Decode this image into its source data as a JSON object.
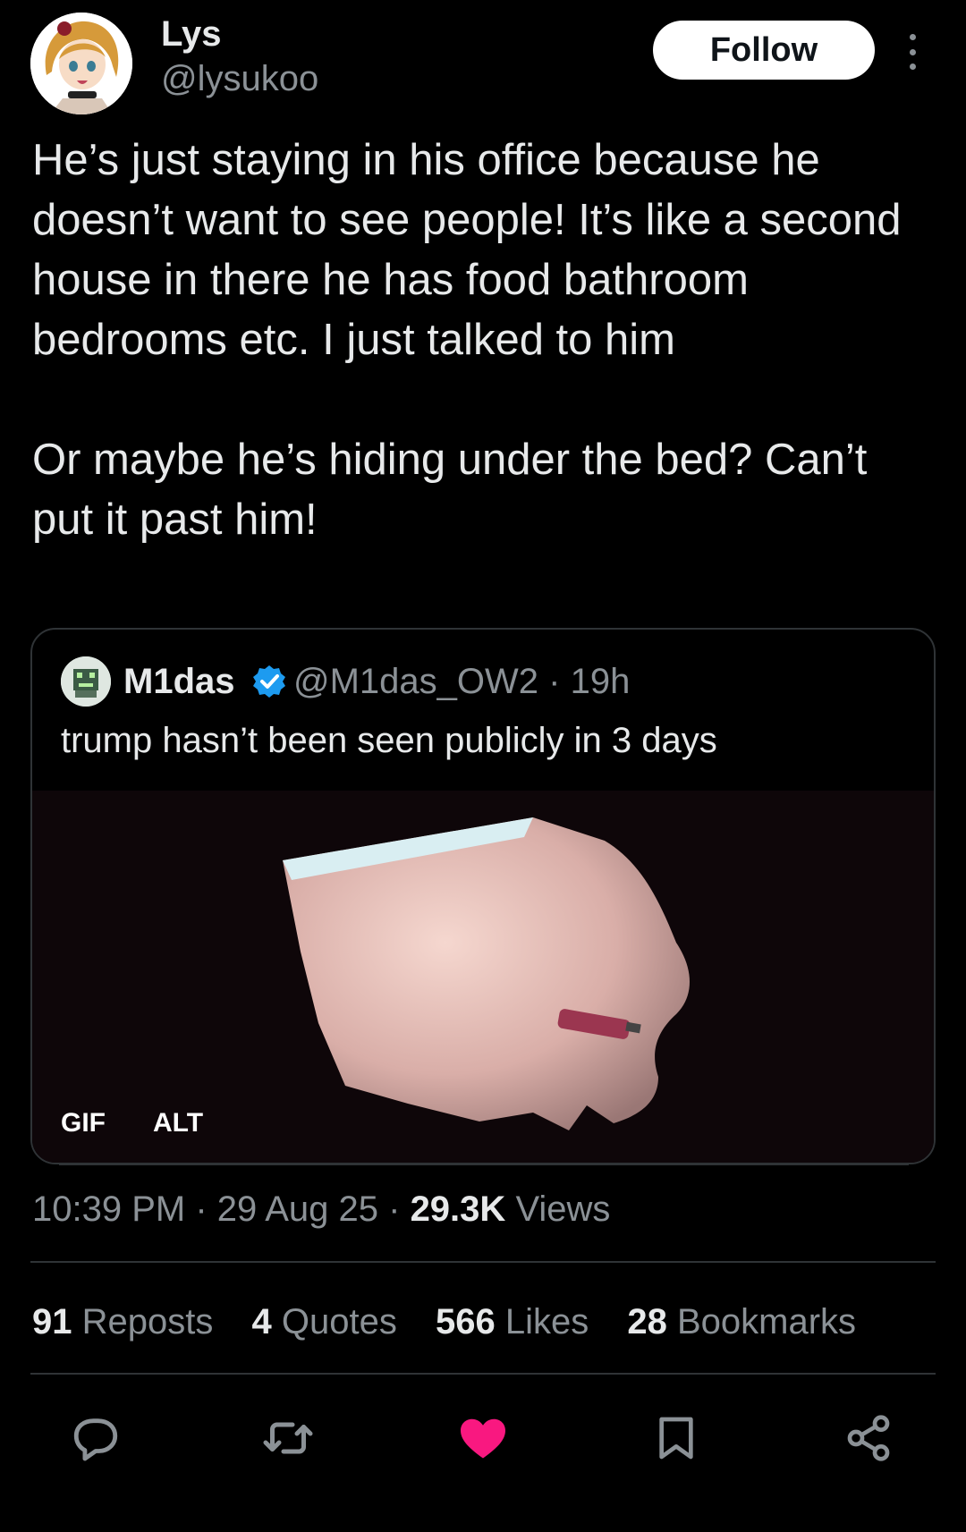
{
  "author": {
    "name": "Lys",
    "handle": "@lysukoo"
  },
  "follow_label": "Follow",
  "tweet": {
    "paragraph1": "He’s just staying in his office because he doesn’t want to see people! It’s like a second house in there he has food bathroom bedrooms etc. I just talked to him",
    "paragraph2": "Or maybe he’s hiding under the bed? Can’t put it past him!"
  },
  "quote": {
    "name": "M1das",
    "handle": "@M1das_OW2",
    "separator": "·",
    "age": "19h",
    "text": "trump hasn’t been seen publicly in 3 days",
    "gif_badge": "GIF",
    "alt_badge": "ALT"
  },
  "meta": {
    "time": "10:39 PM",
    "date": "29 Aug 25",
    "views_count": "29.3K",
    "views_label": "Views",
    "separator": "·"
  },
  "stats": {
    "reposts_count": "91",
    "reposts_label": "Reposts",
    "quotes_count": "4",
    "quotes_label": "Quotes",
    "likes_count": "566",
    "likes_label": "Likes",
    "bookmarks_count": "28",
    "bookmarks_label": "Bookmarks"
  },
  "icons": {
    "reply": "reply-icon",
    "repost": "repost-icon",
    "like": "heart-icon",
    "bookmark": "bookmark-icon",
    "share": "share-icon",
    "verified": "verified-badge-icon",
    "more": "more-vertical-icon"
  },
  "colors": {
    "like": "#f91880",
    "verified": "#1d9bf0",
    "muted": "#8b9196",
    "border": "#2f3336"
  }
}
